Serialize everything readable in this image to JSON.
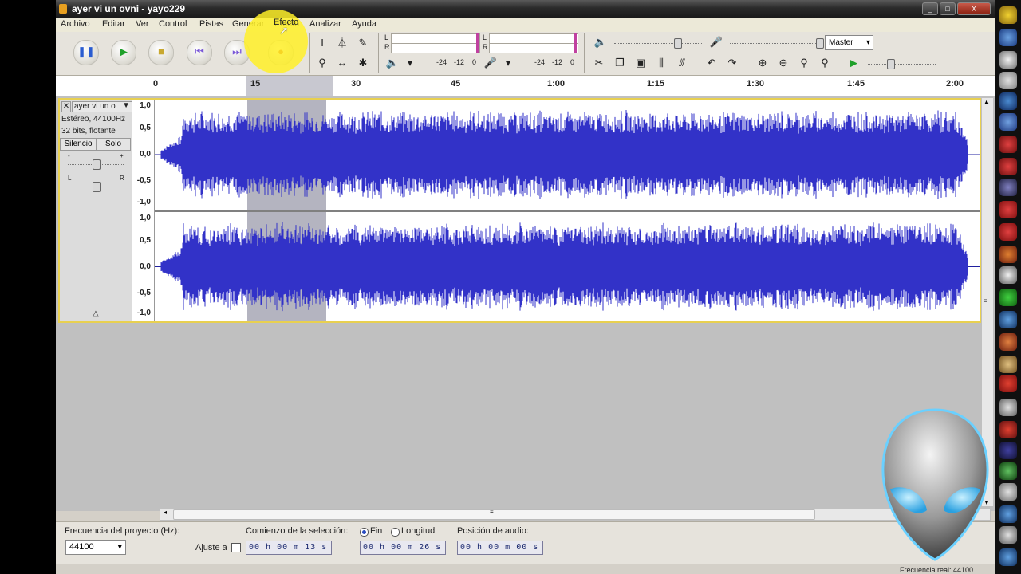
{
  "window": {
    "title": "ayer vi un ovni - yayo229",
    "controls": [
      "_",
      "□",
      "X"
    ]
  },
  "menu": [
    "Archivo",
    "Editar",
    "Ver",
    "Control",
    "Pistas",
    "Generar",
    "Efecto",
    "Analizar",
    "Ayuda"
  ],
  "meters": {
    "play_L": "L",
    "play_R": "R",
    "rec_L": "L",
    "rec_R": "R",
    "scale_play": [
      "-24",
      "-12",
      "0"
    ],
    "scale_rec": [
      "-24",
      "-12",
      "0"
    ]
  },
  "mixer": {
    "source": "Master"
  },
  "ruler": {
    "labels": [
      "0",
      "15",
      "30",
      "45",
      "1:00",
      "1:15",
      "1:30",
      "1:45",
      "2:00"
    ]
  },
  "track": {
    "name": "ayer vi un o",
    "info_line1": "Estéreo, 44100Hz",
    "info_line2": "32 bits, flotante",
    "mute_label": "Silencio",
    "solo_label": "Solo",
    "gain_minus": "-",
    "gain_plus": "+",
    "pan_left": "L",
    "pan_right": "R",
    "vscale": [
      "1,0",
      "0,5",
      "0,0",
      "-0,5",
      "-1,0"
    ]
  },
  "selection_bar": {
    "rate_label": "Frecuencia del proyecto (Hz):",
    "rate_value": "44100",
    "snap_label": "Ajuste a",
    "sel_start_label": "Comienzo de la selección:",
    "end_label": "Fin",
    "length_label": "Longitud",
    "audio_pos_label": "Posición de audio:",
    "start_time": "00 h 00 m 13 s",
    "end_time": "00 h 00 m 26 s",
    "pos_time": "00 h 00 m 00 s"
  },
  "status": {
    "text": "Frecuencia real: 44100"
  },
  "colors": {
    "waveform": "#3232c8",
    "selection": "#b4b4c0",
    "highlight": "#ffee28"
  }
}
